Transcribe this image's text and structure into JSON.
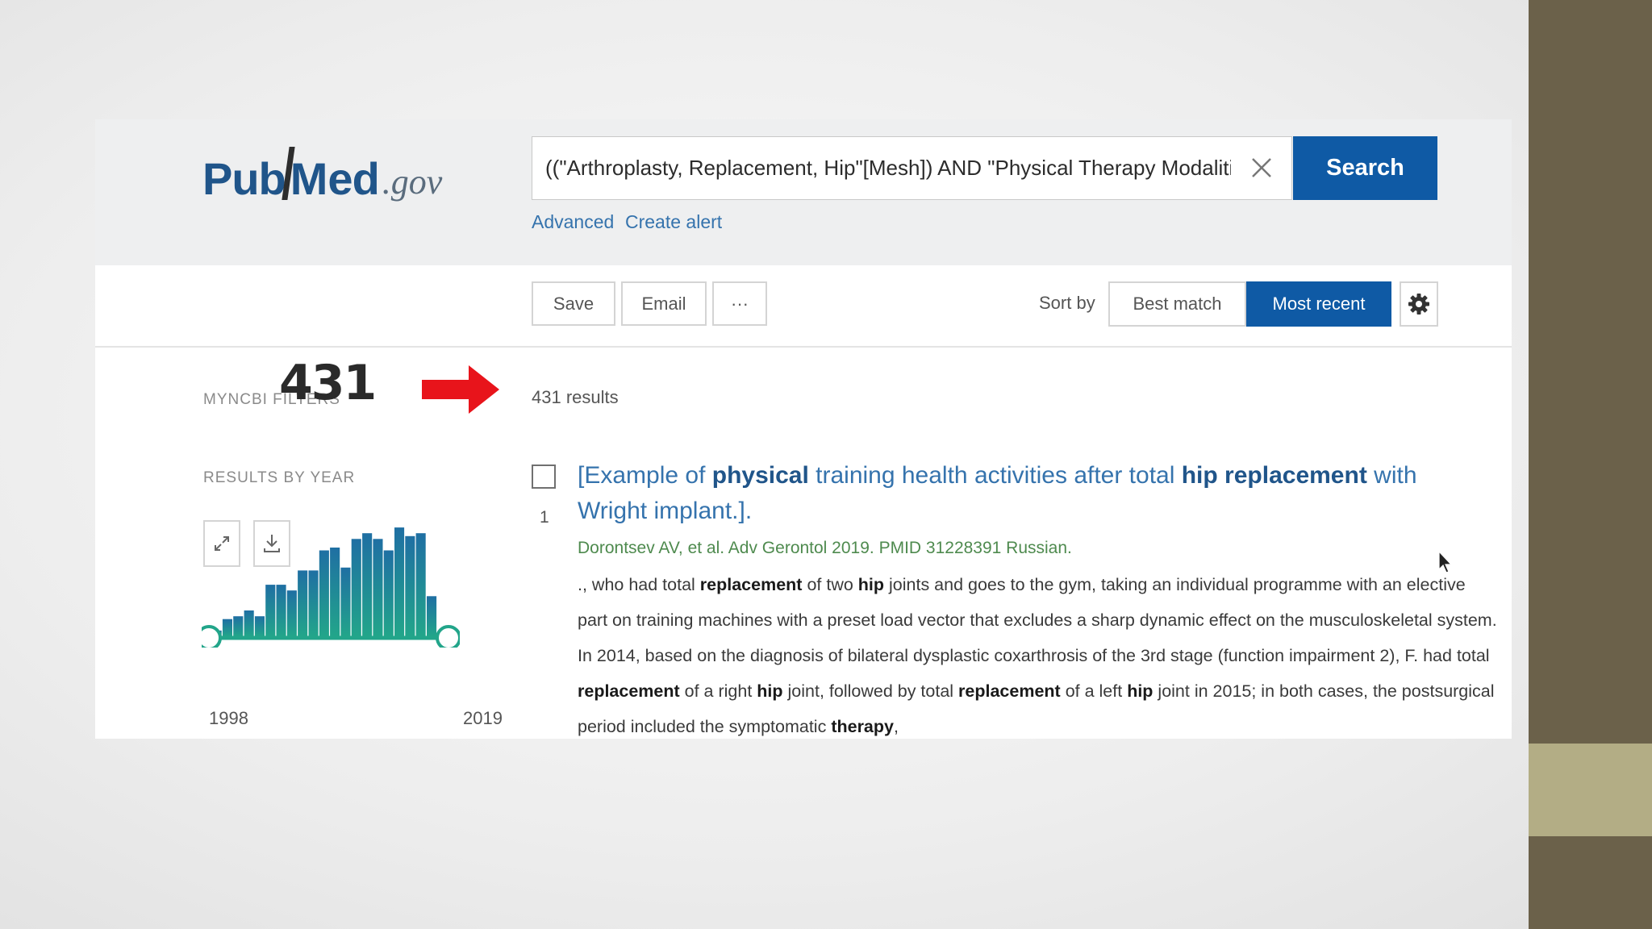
{
  "logo": {
    "pub": "Pub",
    "m": "M",
    "ed": "ed",
    "gov": ".gov"
  },
  "search": {
    "query": "((\"Arthroplasty, Replacement, Hip\"[Mesh]) AND \"Physical Therapy Modalities\"[M",
    "button_label": "Search",
    "links": {
      "advanced": "Advanced",
      "create_alert": "Create alert"
    }
  },
  "toolbar": {
    "save": "Save",
    "email": "Email",
    "more": "···",
    "sort_by": "Sort by",
    "best_match": "Best match",
    "most_recent": "Most recent"
  },
  "sidebar": {
    "myncbi_filters": "MYNCBI FILTERS",
    "results_by_year": "RESULTS BY YEAR",
    "year_start": "1998",
    "year_end": "2019",
    "annotation": "431"
  },
  "results": {
    "count_text": "431 results",
    "items": [
      {
        "number": "1",
        "title_parts": [
          {
            "text": "[Example of ",
            "bold": false
          },
          {
            "text": "physical",
            "bold": true
          },
          {
            "text": " training health activities after total ",
            "bold": false
          },
          {
            "text": "hip replacement",
            "bold": true
          },
          {
            "text": " with Wright implant.].",
            "bold": false
          }
        ],
        "citation": "Dorontsev AV, et al. Adv Gerontol 2019. PMID 31228391 Russian.",
        "snippet_parts": [
          {
            "text": "., who had total ",
            "bold": false
          },
          {
            "text": "replacement",
            "bold": true
          },
          {
            "text": " of two ",
            "bold": false
          },
          {
            "text": "hip",
            "bold": true
          },
          {
            "text": " joints and goes to the gym, taking an individual programme with an elective part on training machines with a preset load vector that excludes a sharp dynamic effect on the musculoskeletal system. In 2014, based on the diagnosis of bilateral dysplastic coxarthrosis of the 3rd stage (function impairment 2), F. had total ",
            "bold": false
          },
          {
            "text": "replacement",
            "bold": true
          },
          {
            "text": " of a right ",
            "bold": false
          },
          {
            "text": "hip",
            "bold": true
          },
          {
            "text": " joint, followed by total ",
            "bold": false
          },
          {
            "text": "replacement",
            "bold": true
          },
          {
            "text": " of a left ",
            "bold": false
          },
          {
            "text": "hip",
            "bold": true
          },
          {
            "text": " joint in 2015; in both cases, the postsurgical period included the symptomatic ",
            "bold": false
          },
          {
            "text": "therapy",
            "bold": true
          },
          {
            "text": ",",
            "bold": false
          }
        ]
      }
    ]
  },
  "chart_data": {
    "type": "bar",
    "x": [
      1998,
      1999,
      2000,
      2001,
      2002,
      2003,
      2004,
      2005,
      2006,
      2007,
      2008,
      2009,
      2010,
      2011,
      2012,
      2013,
      2014,
      2015,
      2016,
      2017,
      2018,
      2019
    ],
    "values": [
      2,
      6,
      7,
      9,
      7,
      18,
      18,
      16,
      23,
      23,
      30,
      31,
      24,
      34,
      36,
      34,
      30,
      38,
      35,
      36,
      14,
      0
    ],
    "ylim": [
      0,
      40
    ],
    "colors": {
      "top": "#1f6fa3",
      "bottom": "#22a58a"
    }
  },
  "colors": {
    "brand": "#20558a",
    "primary_button": "#0f5aa5",
    "link": "#3573ad",
    "citation": "#4e8a4e",
    "annotation_arrow": "#e8141b"
  }
}
